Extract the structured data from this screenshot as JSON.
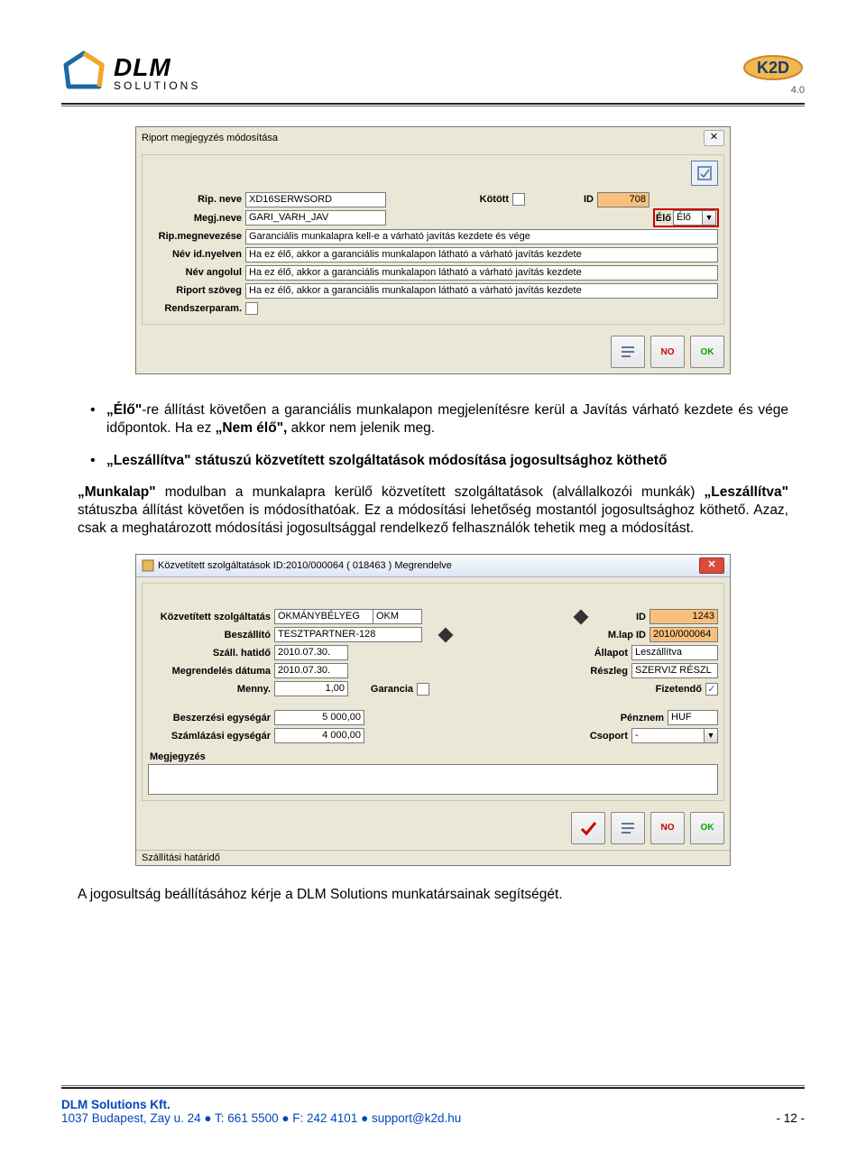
{
  "header": {
    "dlm_name": "DLM",
    "dlm_sub": "SOLUTIONS",
    "k2d_name": "K2D",
    "k2d_ver": "4.0"
  },
  "dialog1": {
    "title": "Riport megjegyzés módosítása",
    "labels": {
      "rip_neve": "Rip. neve",
      "kotott": "Kötött",
      "id": "ID",
      "megj_neve": "Megj.neve",
      "elo": "Élő",
      "rip_megnevezese": "Rip.megnevezése",
      "nev_id": "Név id.nyelven",
      "nev_angol": "Név angolul",
      "riport_szoveg": "Riport szöveg",
      "rendszerparam": "Rendszerparam."
    },
    "values": {
      "rip_neve": "XD16SERWSORD",
      "id": "708",
      "megj_neve": "GARI_VARH_JAV",
      "elo": "Élő",
      "rip_megnevezese": "Garanciális munkalapra kell-e a várható javítás kezdete és vége",
      "nev_id": "Ha ez élő, akkor a garanciális munkalapon látható a várható javítás kezdete",
      "nev_angol": "Ha ez élő, akkor a garanciális munkalapon látható a várható javítás kezdete",
      "riport_szoveg": "Ha ez élő, akkor a garanciális munkalapon látható a várható javítás kezdete"
    },
    "buttons": {
      "no": "NO",
      "ok": "OK"
    }
  },
  "text": {
    "p1a": "„Élő\"",
    "p1b": "-re állítást követően a garanciális munkalapon megjelenítésre kerül a Javítás várható kezdete és vége időpontok. Ha ez ",
    "p1c": "„Nem élő\", ",
    "p1d": "akkor nem jelenik meg.",
    "p2a": "„Leszállítva\" státuszú közvetített szolgáltatások módosítása jogosultsághoz köthető",
    "p3a": "„Munkalap\" ",
    "p3b": "modulban a munkalapra kerülő közvetített szolgáltatások (alvállalkozói munkák) ",
    "p3c": "„Leszállítva\" ",
    "p3d": "státuszba állítást követően is módosíthatóak. Ez a módosítási lehetőség mostantól jogosultsághoz köthető. Azaz, csak a meghatározott módosítási jogosultsággal rendelkező felhasználók tehetik meg a módosítást.",
    "p4": "A jogosultság beállításához kérje a DLM Solutions munkatársainak segítségét."
  },
  "dialog2": {
    "title": "Közvetített szolgáltatások  ID:2010/000064 ( 018463 )  Megrendelve",
    "labels": {
      "kozv": "Közvetített szolgáltatás",
      "id": "ID",
      "beszallito": "Beszállító",
      "mlap": "M.lap ID",
      "szall": "Száll. hatidő",
      "allapot": "Állapot",
      "megr": "Megrendelés dátuma",
      "reszleg": "Részleg",
      "menny": "Menny.",
      "garancia": "Garancia",
      "fizetendo": "Fizetendő",
      "beszerzesi": "Beszerzési egységár",
      "penznem": "Pénznem",
      "szamlazasi": "Számlázási egységár",
      "csoport": "Csoport",
      "megjegyzes": "Megjegyzés"
    },
    "values": {
      "kozv1": "OKMÁNYBÉLYEG",
      "kozv2": "OKM",
      "id": "1243",
      "beszallito": "TESZTPARTNER-128",
      "mlap": "2010/000064",
      "szall": "2010.07.30.",
      "allapot": "Leszállítva",
      "megr": "2010.07.30.",
      "reszleg": "SZERVIZ RÉSZL",
      "menny": "1,00",
      "beszerzesi": "5 000,00",
      "penznem": "HUF",
      "szamlazasi": "4 000,00",
      "csoport": "-",
      "megjegyzes": ""
    },
    "status": "Szállítási határidő",
    "buttons": {
      "no": "NO",
      "ok": "OK"
    }
  },
  "footer": {
    "company": "DLM Solutions Kft.",
    "addr": "1037 Budapest, Zay u. 24 ",
    "tel": "T: 661 5500 ",
    "fax": "F: 242 4101 ",
    "email": "support@k2d.hu",
    "page": "- 12 -",
    "dot": " ● "
  }
}
